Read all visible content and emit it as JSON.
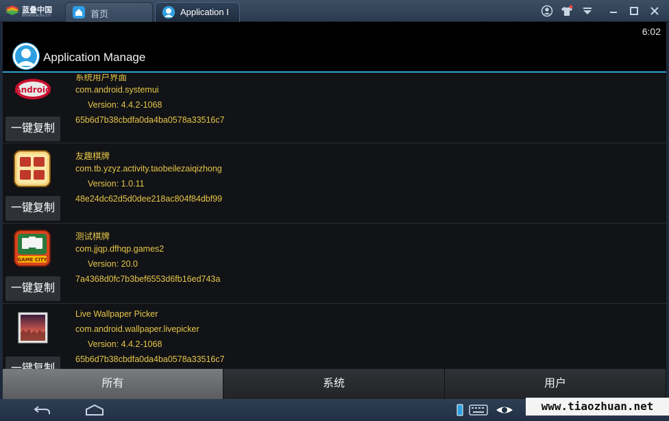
{
  "window": {
    "brand_name": "蓝叠中国",
    "brand_sub": "BlueStacks.cn",
    "tabs": [
      {
        "label": "首页"
      },
      {
        "label": "Application I"
      }
    ]
  },
  "android": {
    "clock": "6:02",
    "title": "Application Manage",
    "copy_label": "一键复制",
    "apps": [
      {
        "name": "系统用户界面",
        "package": "com.android.systemui",
        "version": "Version: 4.4.2-1068",
        "hash": "65b6d7b38cbdfa0da4ba0578a33516c7"
      },
      {
        "name": "友趣棋牌",
        "package": "com.tb.yzyz.activity.taobeilezaiqizhong",
        "version": "Version: 1.0.11",
        "hash": "48e24dc62d5d0dee218ac804f84dbf99"
      },
      {
        "name": "测试棋牌",
        "package": "com.jjqp.dfhqp.games2",
        "version": "Version: 20.0",
        "hash": "7a4368d0fc7b3bef6553d6fb16ed743a"
      },
      {
        "name": "Live Wallpaper Picker",
        "package": "com.android.wallpaper.livepicker",
        "version": "Version: 4.4.2-1068",
        "hash": "65b6d7b38cbdfa0da4ba0578a33516c7"
      }
    ],
    "icon_texts": {
      "android": "Android",
      "game2": "GAME CITY"
    },
    "bottom_tabs": [
      {
        "label": "所有"
      },
      {
        "label": "系统"
      },
      {
        "label": "用户"
      }
    ]
  },
  "watermark": "www.tiaozhuan.net",
  "icons": {
    "window": [
      "account-icon",
      "tshirt-icon",
      "dropdown-icon",
      "minimize-icon",
      "maximize-icon",
      "close-icon"
    ],
    "nav": [
      "back-icon",
      "home-icon",
      "phone-icon",
      "keyboard-icon",
      "eye-icon"
    ]
  }
}
